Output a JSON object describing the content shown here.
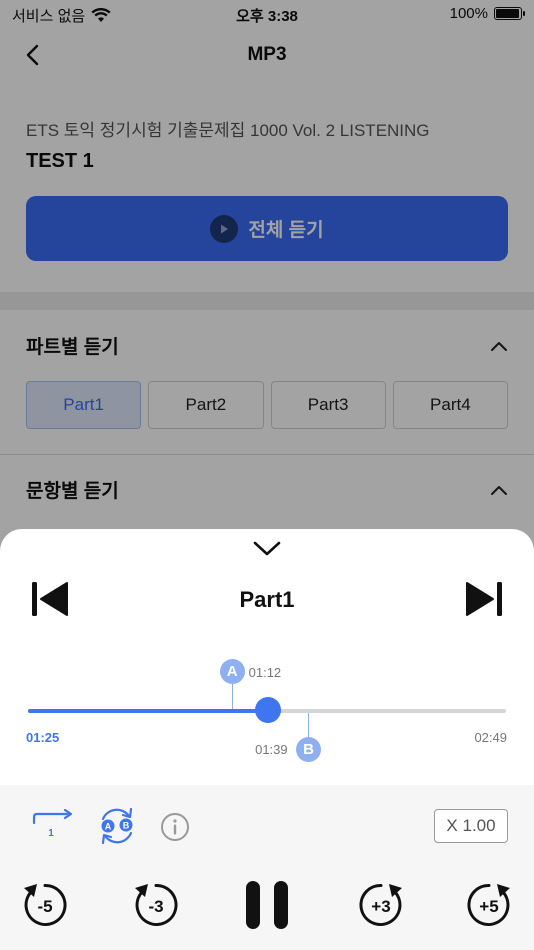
{
  "status_bar": {
    "carrier": "서비스 없음",
    "time": "오후 3:38",
    "battery_text": "100%",
    "battery_level": 1.0
  },
  "nav": {
    "title": "MP3",
    "back_icon": "chevron-left-icon"
  },
  "book": {
    "title": "ETS 토익 정기시험 기출문제집 1000 Vol. 2 LISTENING",
    "test": "TEST 1"
  },
  "play_all": {
    "label": "전체 듣기",
    "icon": "play-icon",
    "color": "#3a6cf4"
  },
  "part_section": {
    "title": "파트별 듣기",
    "parts": [
      {
        "label": "Part1",
        "active": true
      },
      {
        "label": "Part2",
        "active": false
      },
      {
        "label": "Part3",
        "active": false
      },
      {
        "label": "Part4",
        "active": false
      }
    ]
  },
  "question_section": {
    "title": "문항별 듣기"
  },
  "player": {
    "track_title": "Part1",
    "current_time": "01:25",
    "total_time": "02:49",
    "progress": 0.503,
    "marker_a": {
      "label": "A",
      "time": "01:12",
      "position": 0.426
    },
    "marker_b": {
      "label": "B",
      "time": "01:39",
      "position": 0.586
    },
    "speed": "X 1.00",
    "skip_back_5": "-5",
    "skip_back_3": "-3",
    "skip_fwd_3": "+3",
    "skip_fwd_5": "+5",
    "repeat_count": "1",
    "ab_a": "A",
    "ab_b": "B",
    "accent_color": "#3f76f0",
    "marker_color": "#8fb0f0"
  }
}
